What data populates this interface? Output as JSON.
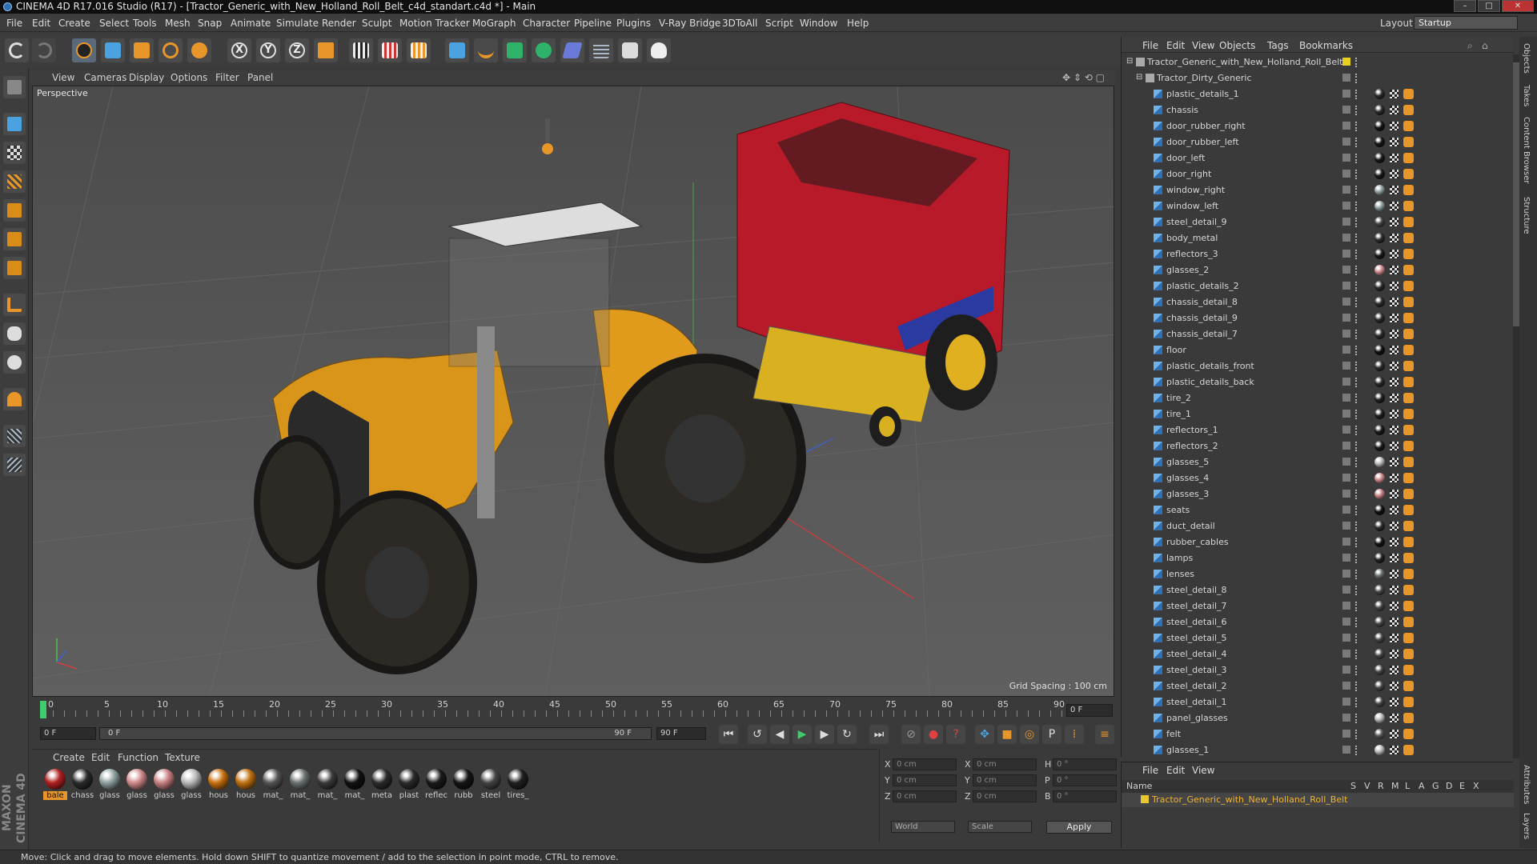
{
  "window": {
    "title": "CINEMA 4D R17.016 Studio (R17) - [Tractor_Generic_with_New_Holland_Roll_Belt_c4d_standart.c4d *] - Main",
    "buttons": [
      "–",
      "□",
      "✕"
    ]
  },
  "menubar": {
    "items": [
      "File",
      "Edit",
      "Create",
      "Select",
      "Tools",
      "Mesh",
      "Snap",
      "Animate",
      "Simulate",
      "Render",
      "Sculpt",
      "Motion Tracker",
      "MoGraph",
      "Character",
      "Pipeline",
      "Plugins",
      "V-Ray Bridge",
      "3DToAll",
      "Script",
      "Window",
      "Help"
    ],
    "layout_label": "Layout:",
    "layout_value": "Startup"
  },
  "toolbar": {
    "axis_x": "X",
    "axis_y": "Y",
    "axis_z": "Z"
  },
  "viewport": {
    "menu": [
      "View",
      "Cameras",
      "Display",
      "Options",
      "Filter",
      "Panel"
    ],
    "label": "Perspective",
    "grid_spacing": "Grid Spacing : 100 cm"
  },
  "timeline": {
    "ticks": [
      "0",
      "5",
      "10",
      "15",
      "20",
      "25",
      "30",
      "35",
      "40",
      "45",
      "50",
      "55",
      "60",
      "65",
      "70",
      "75",
      "80",
      "85",
      "90"
    ],
    "current_frame": "0 F",
    "start": "0 F",
    "range_start": "0 F",
    "range_end": "90 F",
    "end": "90 F"
  },
  "materials": {
    "menu": [
      "Create",
      "Edit",
      "Function",
      "Texture"
    ],
    "items": [
      {
        "label": "bale",
        "color": "#b02020"
      },
      {
        "label": "chass",
        "color": "#2a2a2a"
      },
      {
        "label": "glass",
        "color": "#8fa0a0"
      },
      {
        "label": "glass",
        "color": "#d08a8a"
      },
      {
        "label": "glass",
        "color": "#c88080"
      },
      {
        "label": "glass",
        "color": "#b8b8b8"
      },
      {
        "label": "hous",
        "color": "#c87010"
      },
      {
        "label": "hous",
        "color": "#c07010"
      },
      {
        "label": "mat_",
        "color": "#555555"
      },
      {
        "label": "mat_",
        "color": "#6a7070"
      },
      {
        "label": "mat_",
        "color": "#3a3a3a"
      },
      {
        "label": "mat_",
        "color": "#111111"
      },
      {
        "label": "meta",
        "color": "#2b2b2b"
      },
      {
        "label": "plast",
        "color": "#2a2a2a"
      },
      {
        "label": "reflec",
        "color": "#1a1a1a"
      },
      {
        "label": "rubb",
        "color": "#151515"
      },
      {
        "label": "steel",
        "color": "#444444"
      },
      {
        "label": "tires_",
        "color": "#202020"
      }
    ]
  },
  "coords": {
    "rows": [
      {
        "l1": "X",
        "v1": "0 cm",
        "l2": "X",
        "v2": "0 cm",
        "l3": "H",
        "v3": "0 °"
      },
      {
        "l1": "Y",
        "v1": "0 cm",
        "l2": "Y",
        "v2": "0 cm",
        "l3": "P",
        "v3": "0 °"
      },
      {
        "l1": "Z",
        "v1": "0 cm",
        "l2": "Z",
        "v2": "0 cm",
        "l3": "B",
        "v3": "0 °"
      }
    ],
    "mode1": "World",
    "mode2": "Scale",
    "apply": "Apply"
  },
  "status": "Move: Click and drag to move elements. Hold down SHIFT to quantize movement / add to the selection in point mode, CTRL to remove.",
  "brand": "MAXON CINEMA 4D",
  "objects": {
    "menu": [
      "File",
      "Edit",
      "View",
      "Objects",
      "Tags",
      "Bookmarks"
    ],
    "root": "Tractor_Generic_with_New_Holland_Roll_Belt",
    "group": "Tractor_Dirty_Generic",
    "items": [
      {
        "name": "plastic_details_1",
        "mat": "#2a2a2a"
      },
      {
        "name": "chassis",
        "mat": "#2a2a2a"
      },
      {
        "name": "door_rubber_right",
        "mat": "#151515"
      },
      {
        "name": "door_rubber_left",
        "mat": "#151515"
      },
      {
        "name": "door_left",
        "mat": "#1a1a1a"
      },
      {
        "name": "door_right",
        "mat": "#1a1a1a"
      },
      {
        "name": "window_right",
        "mat": "#8fa0a0"
      },
      {
        "name": "window_left",
        "mat": "#8fa0a0"
      },
      {
        "name": "steel_detail_9",
        "mat": "#444444"
      },
      {
        "name": "body_metal",
        "mat": "#2b2b2b"
      },
      {
        "name": "reflectors_3",
        "mat": "#1a1a1a"
      },
      {
        "name": "glasses_2",
        "mat": "#d08a8a"
      },
      {
        "name": "plastic_details_2",
        "mat": "#2a2a2a"
      },
      {
        "name": "chassis_detail_8",
        "mat": "#2a2a2a"
      },
      {
        "name": "chassis_detail_9",
        "mat": "#2a2a2a"
      },
      {
        "name": "chassis_detail_7",
        "mat": "#2a2a2a"
      },
      {
        "name": "floor",
        "mat": "#111111"
      },
      {
        "name": "plastic_details_front",
        "mat": "#2a2a2a"
      },
      {
        "name": "plastic_details_back",
        "mat": "#2a2a2a"
      },
      {
        "name": "tire_2",
        "mat": "#202020"
      },
      {
        "name": "tire_1",
        "mat": "#202020"
      },
      {
        "name": "reflectors_1",
        "mat": "#1a1a1a"
      },
      {
        "name": "reflectors_2",
        "mat": "#1a1a1a"
      },
      {
        "name": "glasses_5",
        "mat": "#b8b8b8"
      },
      {
        "name": "glasses_4",
        "mat": "#d08a8a"
      },
      {
        "name": "glasses_3",
        "mat": "#c88080"
      },
      {
        "name": "seats",
        "mat": "#111111"
      },
      {
        "name": "duct_detail",
        "mat": "#2a2a2a"
      },
      {
        "name": "rubber_cables",
        "mat": "#151515"
      },
      {
        "name": "lamps",
        "mat": "#222222"
      },
      {
        "name": "lenses",
        "mat": "#6a7070"
      },
      {
        "name": "steel_detail_8",
        "mat": "#444444"
      },
      {
        "name": "steel_detail_7",
        "mat": "#444444"
      },
      {
        "name": "steel_detail_6",
        "mat": "#444444"
      },
      {
        "name": "steel_detail_5",
        "mat": "#444444"
      },
      {
        "name": "steel_detail_4",
        "mat": "#444444"
      },
      {
        "name": "steel_detail_3",
        "mat": "#444444"
      },
      {
        "name": "steel_detail_2",
        "mat": "#444444"
      },
      {
        "name": "steel_detail_1",
        "mat": "#444444"
      },
      {
        "name": "panel_glasses",
        "mat": "#b8b8b8"
      },
      {
        "name": "felt",
        "mat": "#555555"
      },
      {
        "name": "glasses_1",
        "mat": "#b8b8b8"
      }
    ]
  },
  "layers": {
    "menu": [
      "File",
      "Edit",
      "View"
    ],
    "columns": [
      "Name",
      "S",
      "V",
      "R",
      "M",
      "L",
      "A",
      "G",
      "D",
      "E",
      "X"
    ],
    "row": "Tractor_Generic_with_New_Holland_Roll_Belt"
  },
  "sidetabs": [
    "Objects",
    "Takes",
    "Content Browser",
    "Structure",
    "Attributes",
    "Layers"
  ],
  "colors": {
    "accent_orange": "#e8962a",
    "accent_blue": "#4aa3e0",
    "layer_yellow": "#f2b433"
  }
}
